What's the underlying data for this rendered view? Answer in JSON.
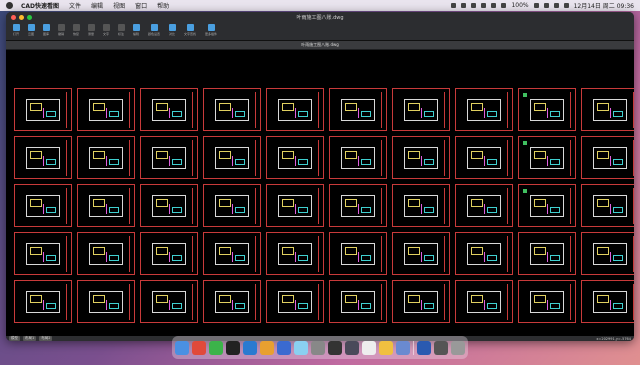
{
  "menubar": {
    "app_name": "CAD快速看图",
    "items": [
      "文件",
      "编辑",
      "视图",
      "窗口",
      "帮助"
    ],
    "battery": "100%",
    "clock": "12月14日 周二  09:36"
  },
  "window": {
    "title": "叶雨施工图八账.dwg",
    "traffic_colors": [
      "#ff5f57",
      "#febc2e",
      "#28c840"
    ]
  },
  "toolbar": [
    {
      "label": "打开",
      "icon": "folder-open-icon",
      "enabled": true
    },
    {
      "label": "云图",
      "icon": "cloud-icon",
      "enabled": true
    },
    {
      "label": "图库",
      "icon": "library-icon",
      "enabled": true
    },
    {
      "label": "撤销",
      "icon": "undo-icon",
      "enabled": false
    },
    {
      "label": "恢复",
      "icon": "redo-icon",
      "enabled": false
    },
    {
      "label": "测量",
      "icon": "measure-icon",
      "enabled": false
    },
    {
      "label": "文字",
      "icon": "text-icon",
      "enabled": false
    },
    {
      "label": "标注",
      "icon": "annotate-icon",
      "enabled": false
    },
    {
      "label": "编辑",
      "icon": "edit-icon",
      "enabled": true
    },
    {
      "label": "颜色设置",
      "icon": "palette-icon",
      "enabled": true
    },
    {
      "label": "对比",
      "icon": "compare-icon",
      "enabled": true
    },
    {
      "label": "文字查找",
      "icon": "text-search-icon",
      "enabled": true
    },
    {
      "label": "更多插件",
      "icon": "plugins-icon",
      "enabled": true
    }
  ],
  "document_tab": "叶雨施工图八账.dwg",
  "statusbar": {
    "tabs": [
      "模型",
      "布局1",
      "布局2"
    ],
    "coords": "x=202991,y=-5764"
  },
  "drawing": {
    "rows": 5,
    "cols": 11,
    "frame_color": "#c83a3a"
  },
  "dock": [
    "finder-icon",
    "chrome-icon",
    "wechat-icon",
    "qq-icon",
    "vscode-icon",
    "photos-icon",
    "pen-icon",
    "cloud-drive-icon",
    "settings-icon",
    "cad-icon",
    "screen-icon",
    "notes-icon",
    "launchpad-icon",
    "files-icon",
    "cad-viewer-icon",
    "window-icon",
    "trash-icon"
  ]
}
